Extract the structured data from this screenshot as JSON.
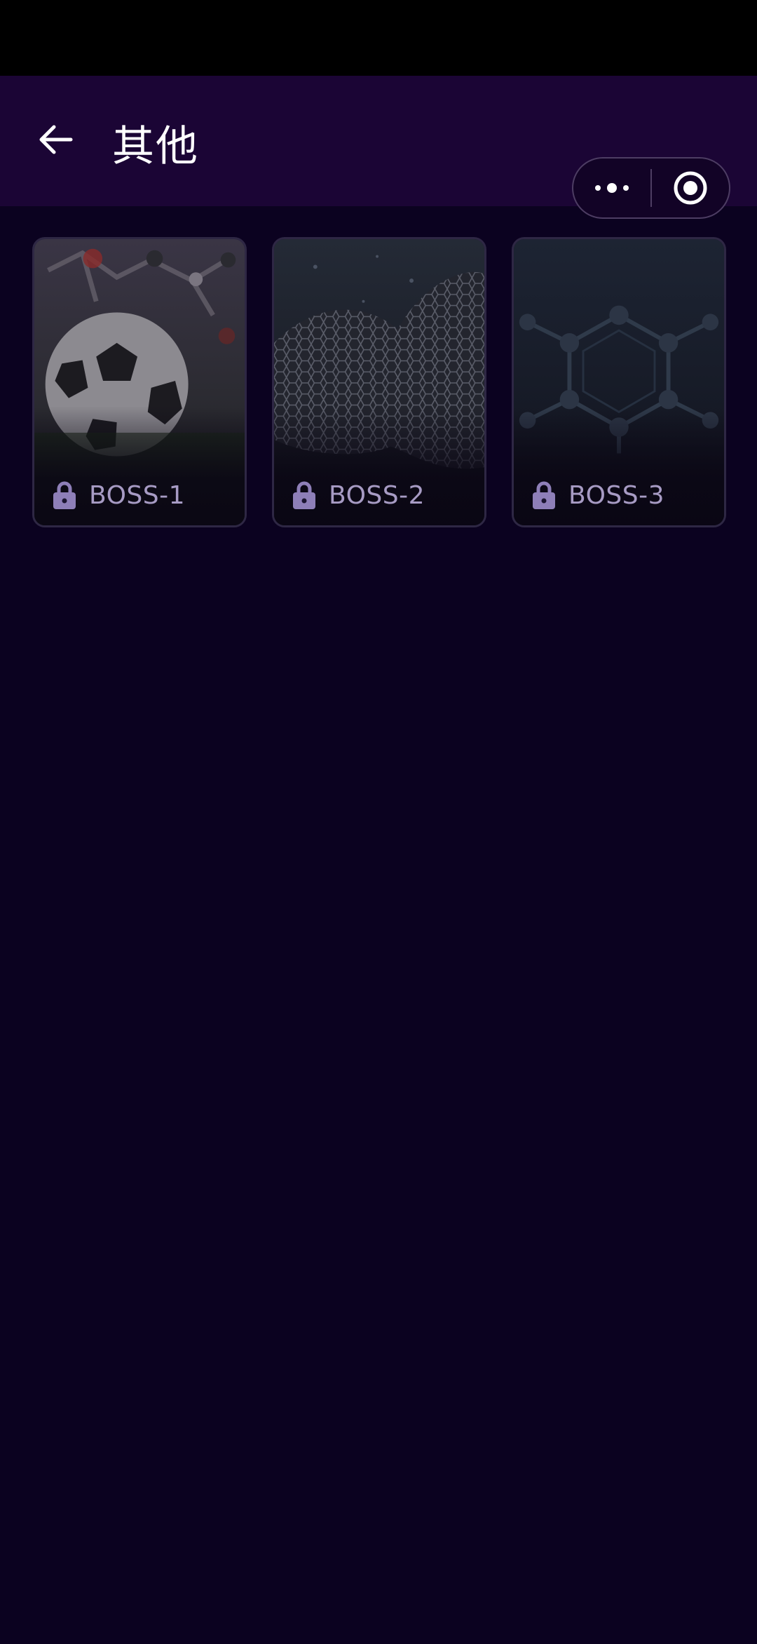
{
  "header": {
    "title": "其他"
  },
  "levels": [
    {
      "label": "BOSS-1",
      "locked": true,
      "art": "soccer-ball-molecule"
    },
    {
      "label": "BOSS-2",
      "locked": true,
      "art": "carbon-lattice-sheet"
    },
    {
      "label": "BOSS-3",
      "locked": true,
      "art": "hexagon-molecule"
    }
  ],
  "icons": {
    "back": "back-arrow-icon",
    "more": "more-dots-icon",
    "close": "close-target-icon",
    "lock": "lock-icon"
  },
  "colors": {
    "background": "#0b0220",
    "header": "#1b0535",
    "card_border": "#2e2744",
    "lock": "#8e7fb8",
    "label": "#a79bc4"
  }
}
